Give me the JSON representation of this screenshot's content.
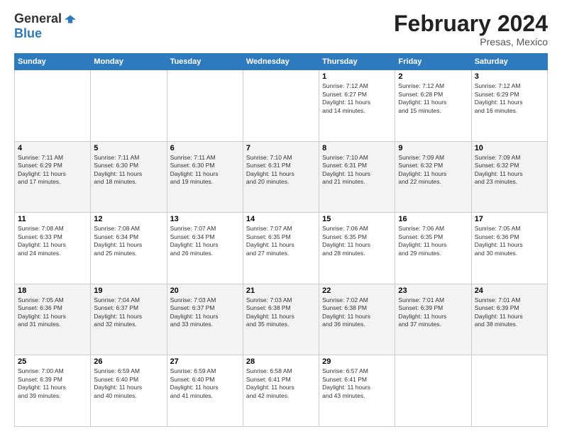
{
  "logo": {
    "general": "General",
    "blue": "Blue"
  },
  "header": {
    "month": "February 2024",
    "location": "Presas, Mexico"
  },
  "weekdays": [
    "Sunday",
    "Monday",
    "Tuesday",
    "Wednesday",
    "Thursday",
    "Friday",
    "Saturday"
  ],
  "weeks": [
    [
      {
        "date": "",
        "info": ""
      },
      {
        "date": "",
        "info": ""
      },
      {
        "date": "",
        "info": ""
      },
      {
        "date": "",
        "info": ""
      },
      {
        "date": "1",
        "info": "Sunrise: 7:12 AM\nSunset: 6:27 PM\nDaylight: 11 hours\nand 14 minutes."
      },
      {
        "date": "2",
        "info": "Sunrise: 7:12 AM\nSunset: 6:28 PM\nDaylight: 11 hours\nand 15 minutes."
      },
      {
        "date": "3",
        "info": "Sunrise: 7:12 AM\nSunset: 6:29 PM\nDaylight: 11 hours\nand 16 minutes."
      }
    ],
    [
      {
        "date": "4",
        "info": "Sunrise: 7:11 AM\nSunset: 6:29 PM\nDaylight: 11 hours\nand 17 minutes."
      },
      {
        "date": "5",
        "info": "Sunrise: 7:11 AM\nSunset: 6:30 PM\nDaylight: 11 hours\nand 18 minutes."
      },
      {
        "date": "6",
        "info": "Sunrise: 7:11 AM\nSunset: 6:30 PM\nDaylight: 11 hours\nand 19 minutes."
      },
      {
        "date": "7",
        "info": "Sunrise: 7:10 AM\nSunset: 6:31 PM\nDaylight: 11 hours\nand 20 minutes."
      },
      {
        "date": "8",
        "info": "Sunrise: 7:10 AM\nSunset: 6:31 PM\nDaylight: 11 hours\nand 21 minutes."
      },
      {
        "date": "9",
        "info": "Sunrise: 7:09 AM\nSunset: 6:32 PM\nDaylight: 11 hours\nand 22 minutes."
      },
      {
        "date": "10",
        "info": "Sunrise: 7:09 AM\nSunset: 6:32 PM\nDaylight: 11 hours\nand 23 minutes."
      }
    ],
    [
      {
        "date": "11",
        "info": "Sunrise: 7:08 AM\nSunset: 6:33 PM\nDaylight: 11 hours\nand 24 minutes."
      },
      {
        "date": "12",
        "info": "Sunrise: 7:08 AM\nSunset: 6:34 PM\nDaylight: 11 hours\nand 25 minutes."
      },
      {
        "date": "13",
        "info": "Sunrise: 7:07 AM\nSunset: 6:34 PM\nDaylight: 11 hours\nand 26 minutes."
      },
      {
        "date": "14",
        "info": "Sunrise: 7:07 AM\nSunset: 6:35 PM\nDaylight: 11 hours\nand 27 minutes."
      },
      {
        "date": "15",
        "info": "Sunrise: 7:06 AM\nSunset: 6:35 PM\nDaylight: 11 hours\nand 28 minutes."
      },
      {
        "date": "16",
        "info": "Sunrise: 7:06 AM\nSunset: 6:35 PM\nDaylight: 11 hours\nand 29 minutes."
      },
      {
        "date": "17",
        "info": "Sunrise: 7:05 AM\nSunset: 6:36 PM\nDaylight: 11 hours\nand 30 minutes."
      }
    ],
    [
      {
        "date": "18",
        "info": "Sunrise: 7:05 AM\nSunset: 6:36 PM\nDaylight: 11 hours\nand 31 minutes."
      },
      {
        "date": "19",
        "info": "Sunrise: 7:04 AM\nSunset: 6:37 PM\nDaylight: 11 hours\nand 32 minutes."
      },
      {
        "date": "20",
        "info": "Sunrise: 7:03 AM\nSunset: 6:37 PM\nDaylight: 11 hours\nand 33 minutes."
      },
      {
        "date": "21",
        "info": "Sunrise: 7:03 AM\nSunset: 6:38 PM\nDaylight: 11 hours\nand 35 minutes."
      },
      {
        "date": "22",
        "info": "Sunrise: 7:02 AM\nSunset: 6:38 PM\nDaylight: 11 hours\nand 36 minutes."
      },
      {
        "date": "23",
        "info": "Sunrise: 7:01 AM\nSunset: 6:39 PM\nDaylight: 11 hours\nand 37 minutes."
      },
      {
        "date": "24",
        "info": "Sunrise: 7:01 AM\nSunset: 6:39 PM\nDaylight: 11 hours\nand 38 minutes."
      }
    ],
    [
      {
        "date": "25",
        "info": "Sunrise: 7:00 AM\nSunset: 6:39 PM\nDaylight: 11 hours\nand 39 minutes."
      },
      {
        "date": "26",
        "info": "Sunrise: 6:59 AM\nSunset: 6:40 PM\nDaylight: 11 hours\nand 40 minutes."
      },
      {
        "date": "27",
        "info": "Sunrise: 6:59 AM\nSunset: 6:40 PM\nDaylight: 11 hours\nand 41 minutes."
      },
      {
        "date": "28",
        "info": "Sunrise: 6:58 AM\nSunset: 6:41 PM\nDaylight: 11 hours\nand 42 minutes."
      },
      {
        "date": "29",
        "info": "Sunrise: 6:57 AM\nSunset: 6:41 PM\nDaylight: 11 hours\nand 43 minutes."
      },
      {
        "date": "",
        "info": ""
      },
      {
        "date": "",
        "info": ""
      }
    ]
  ]
}
